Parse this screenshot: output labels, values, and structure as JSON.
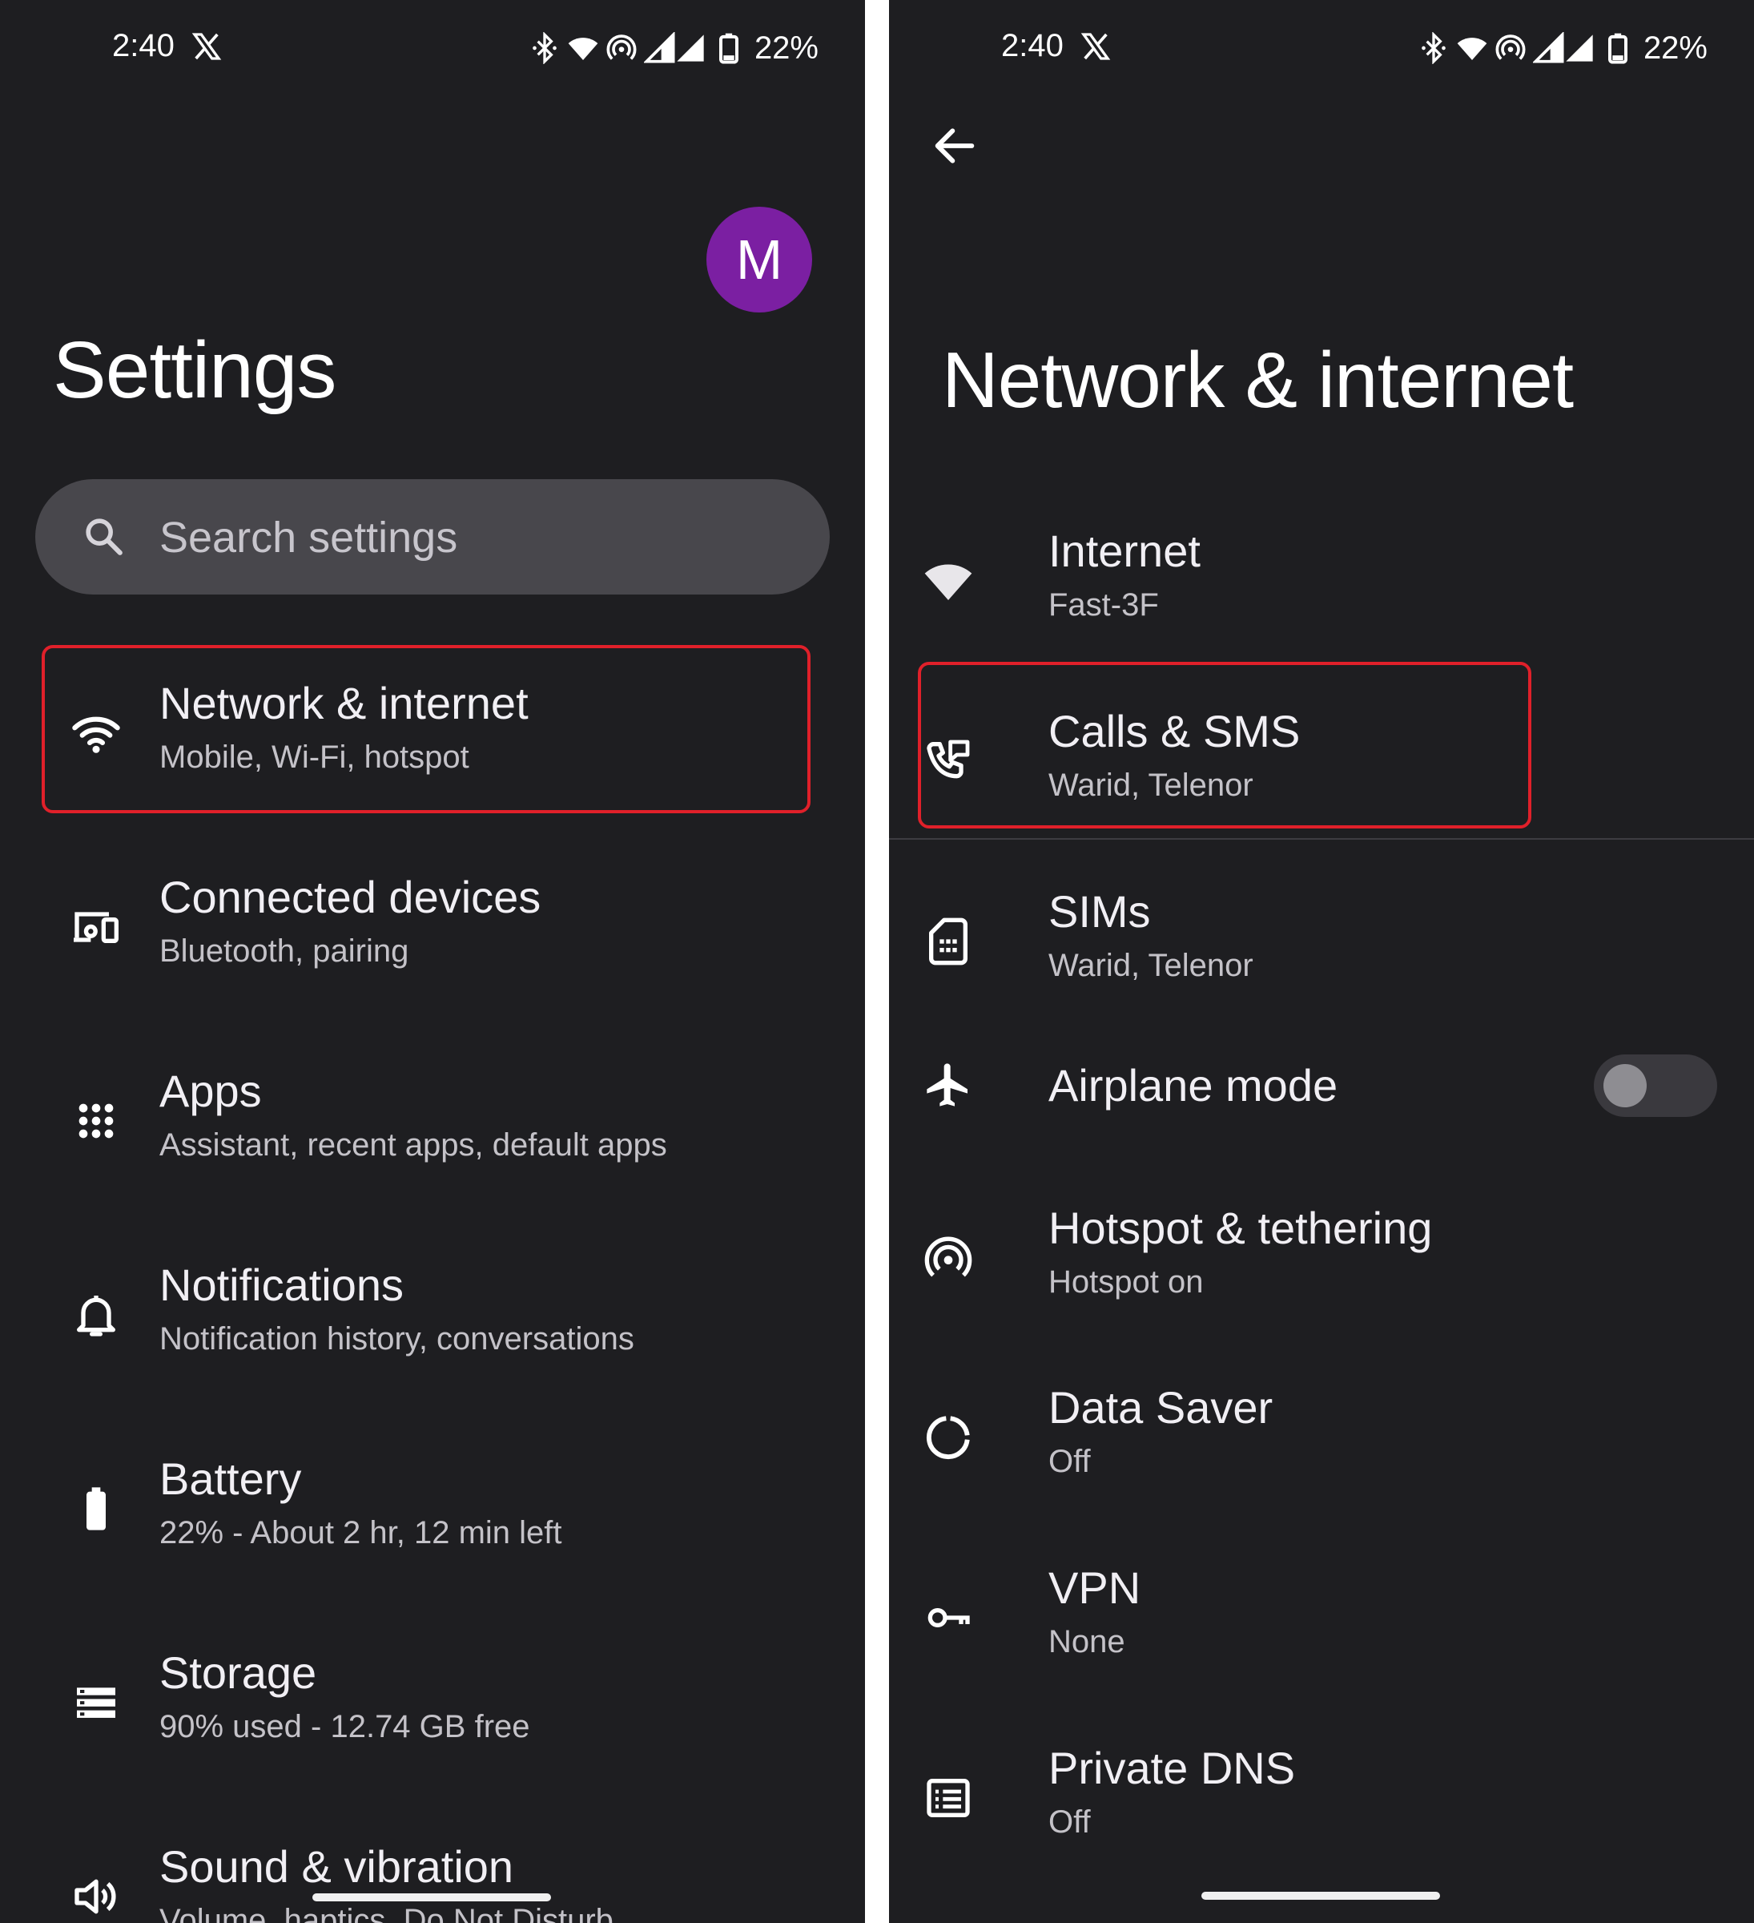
{
  "left": {
    "status": {
      "time": "2:40",
      "battery": "22%"
    },
    "avatar_letter": "M",
    "title": "Settings",
    "search": {
      "placeholder": "Search settings"
    },
    "items": [
      {
        "title": "Network & internet",
        "subtitle": "Mobile, Wi-Fi, hotspot",
        "icon": "wifi-icon",
        "highlighted": true
      },
      {
        "title": "Connected devices",
        "subtitle": "Bluetooth, pairing",
        "icon": "devices-icon"
      },
      {
        "title": "Apps",
        "subtitle": "Assistant, recent apps, default apps",
        "icon": "apps-grid-icon"
      },
      {
        "title": "Notifications",
        "subtitle": "Notification history, conversations",
        "icon": "bell-icon"
      },
      {
        "title": "Battery",
        "subtitle": "22% - About 2 hr, 12 min left",
        "icon": "battery-icon"
      },
      {
        "title": "Storage",
        "subtitle": "90% used - 12.74 GB free",
        "icon": "storage-icon"
      },
      {
        "title": "Sound & vibration",
        "subtitle": "Volume, haptics, Do Not Disturb",
        "icon": "speaker-icon"
      }
    ]
  },
  "right": {
    "status": {
      "time": "2:40",
      "battery": "22%"
    },
    "title": "Network & internet",
    "items": [
      {
        "title": "Internet",
        "subtitle": "Fast-3F",
        "icon": "wifi-filled-icon"
      },
      {
        "title": "Calls & SMS",
        "subtitle": "Warid, Telenor",
        "icon": "phone-message-icon",
        "highlighted": true
      },
      {
        "title": "SIMs",
        "subtitle": "Warid, Telenor",
        "icon": "sim-card-icon"
      },
      {
        "title": "Airplane mode",
        "subtitle": "",
        "icon": "airplane-icon",
        "toggle": "off"
      },
      {
        "title": "Hotspot & tethering",
        "subtitle": "Hotspot on",
        "icon": "hotspot-icon"
      },
      {
        "title": "Data Saver",
        "subtitle": "Off",
        "icon": "data-saver-icon"
      },
      {
        "title": "VPN",
        "subtitle": "None",
        "icon": "vpn-key-icon"
      },
      {
        "title": "Private DNS",
        "subtitle": "Off",
        "icon": "dns-icon"
      }
    ]
  },
  "colors": {
    "background": "#1e1e21",
    "highlight": "#e0202a",
    "avatar": "#7b1fa2",
    "search_bar": "#48474c"
  }
}
